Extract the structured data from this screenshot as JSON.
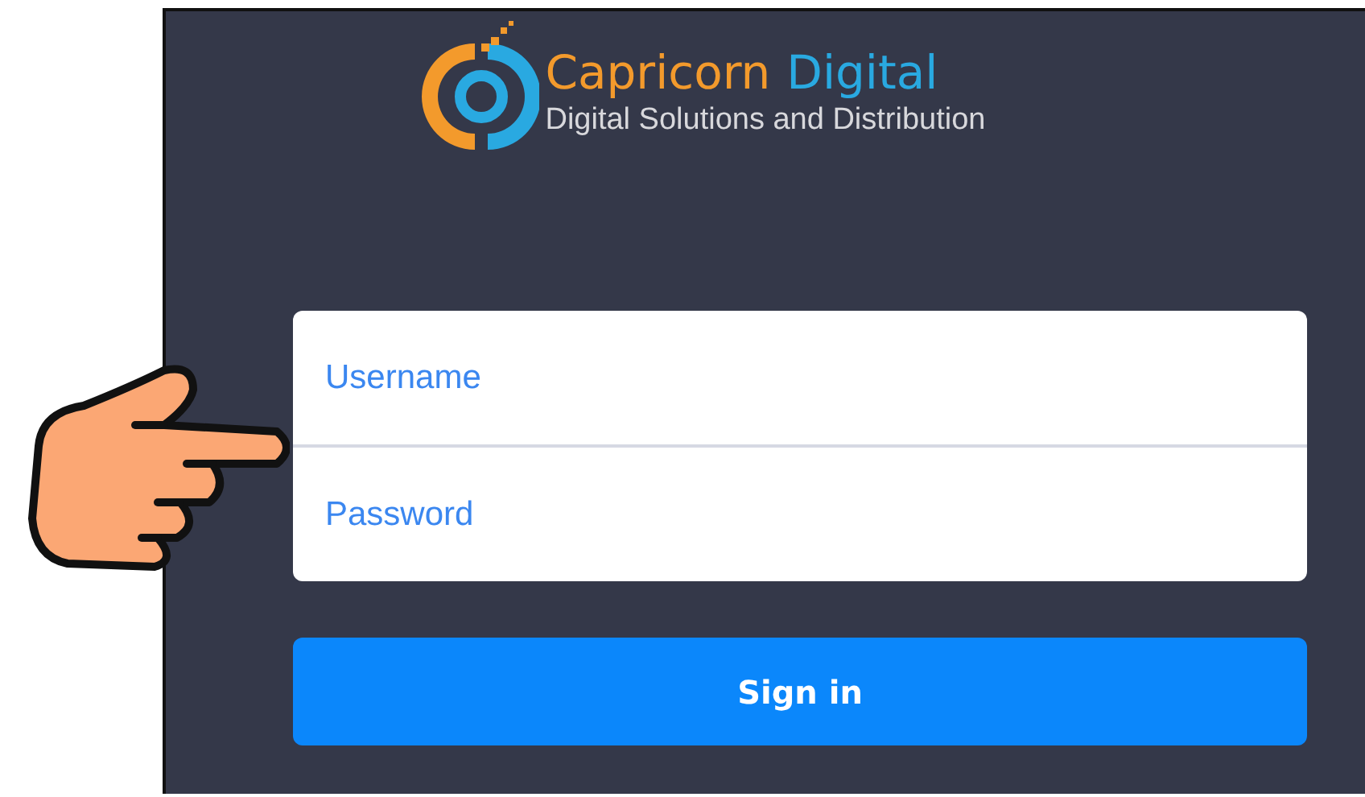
{
  "logo": {
    "brand": "Capricorn",
    "brand_accent": "Digital",
    "tagline": "Digital Solutions and Distribution"
  },
  "fields": [
    {
      "placeholder": "Username"
    },
    {
      "placeholder": "Password"
    }
  ],
  "sign_in_button": {
    "label": "Sign in"
  }
}
